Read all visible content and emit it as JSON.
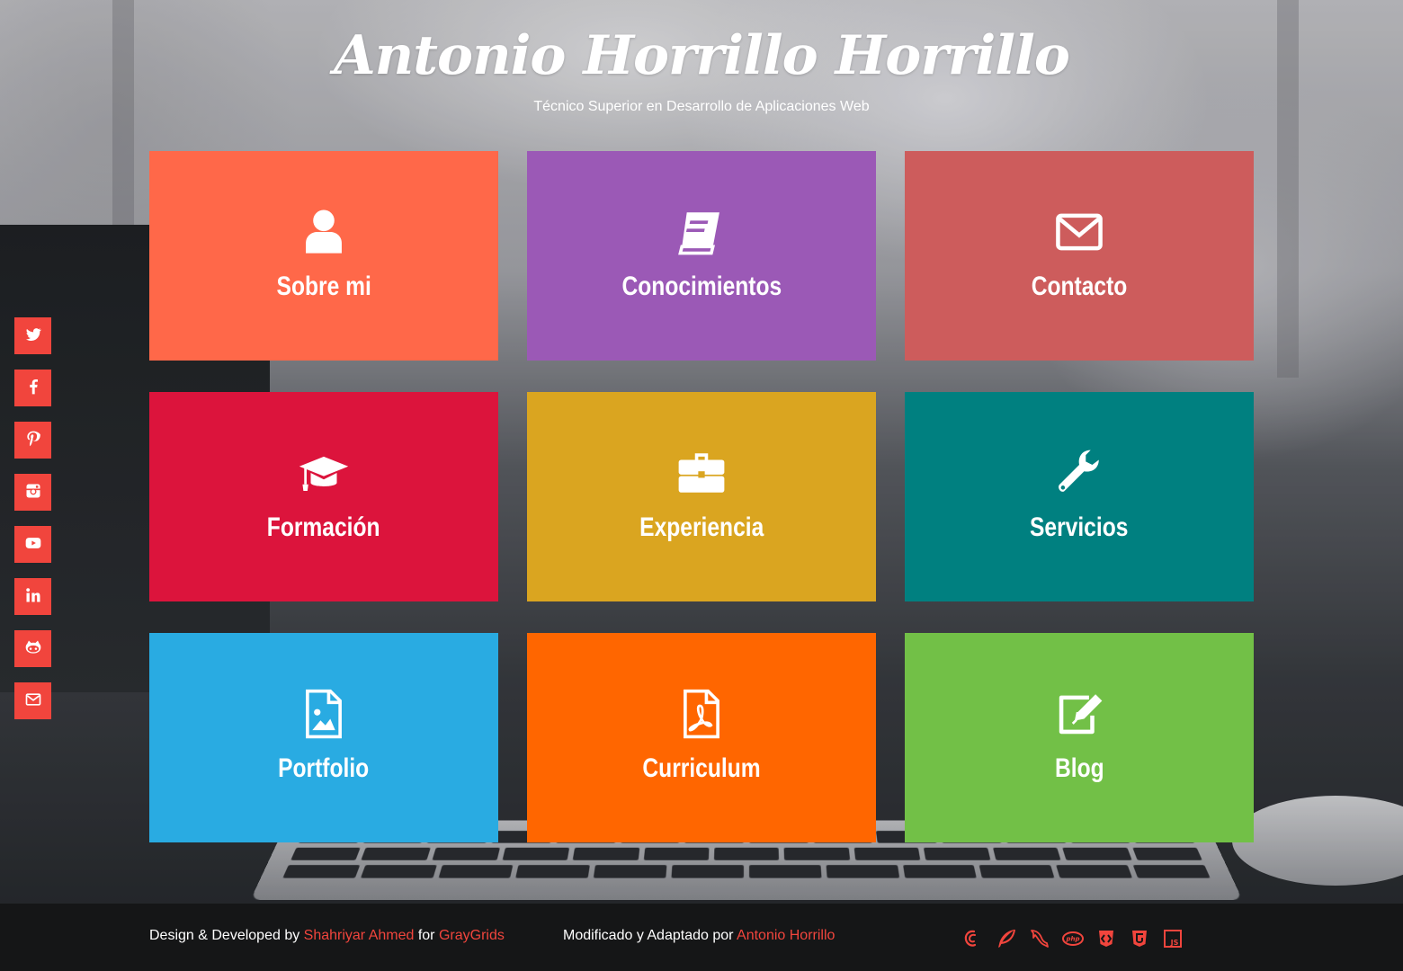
{
  "header": {
    "title": "Antonio Horrillo Horrillo",
    "subtitle": "Técnico Superior en Desarrollo de Aplicaciones Web"
  },
  "tiles": [
    {
      "label": "Sobre mi",
      "icon": "user-icon",
      "color": "#ff6849"
    },
    {
      "label": "Conocimientos",
      "icon": "book-icon",
      "color": "#9b59b6"
    },
    {
      "label": "Contacto",
      "icon": "envelope-icon",
      "color": "#cd5c5c"
    },
    {
      "label": "Formación",
      "icon": "graduation-cap-icon",
      "color": "#dc143c"
    },
    {
      "label": "Experiencia",
      "icon": "briefcase-icon",
      "color": "#daa520"
    },
    {
      "label": "Servicios",
      "icon": "wrench-icon",
      "color": "#008080"
    },
    {
      "label": "Portfolio",
      "icon": "image-file-icon",
      "color": "#29abe2"
    },
    {
      "label": "Curriculum",
      "icon": "pdf-file-icon",
      "color": "#ff6600"
    },
    {
      "label": "Blog",
      "icon": "edit-icon",
      "color": "#72c047"
    }
  ],
  "social": [
    {
      "icon": "twitter-icon"
    },
    {
      "icon": "facebook-icon"
    },
    {
      "icon": "pinterest-icon"
    },
    {
      "icon": "instagram-icon"
    },
    {
      "icon": "youtube-icon"
    },
    {
      "icon": "linkedin-icon"
    },
    {
      "icon": "github-icon"
    },
    {
      "icon": "mail-icon"
    }
  ],
  "footer": {
    "credit_prefix": "Design & Developed by ",
    "author_link": "Shahriyar Ahmed",
    "credit_for": " for ",
    "company_link": "GrayGrids",
    "modified_prefix": "Modificado y Adaptado por ",
    "modifier_link": "Antonio Horrillo",
    "tech_icons": [
      "debian-icon",
      "feather-icon",
      "mysql-dolphin-icon",
      "php-icon",
      "git-icon",
      "html5-icon",
      "js-icon"
    ]
  },
  "colors": {
    "accent": "#f1453d",
    "footer_bg": "#151617"
  }
}
